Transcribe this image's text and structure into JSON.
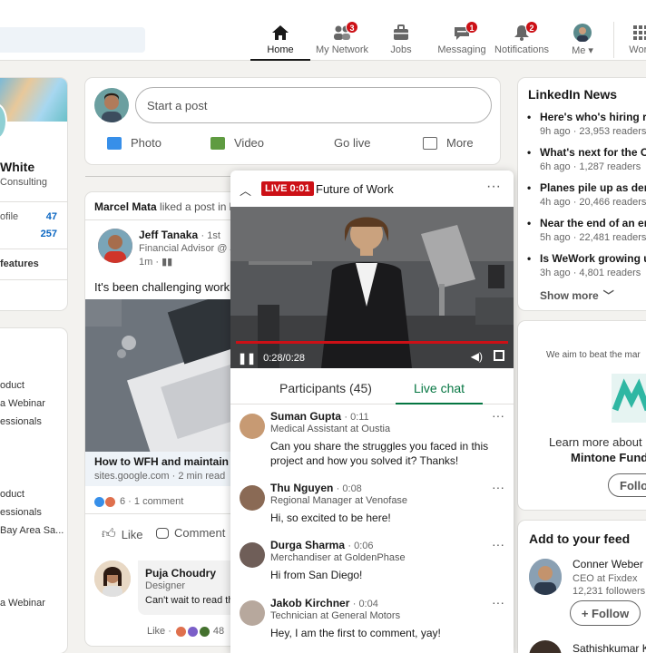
{
  "nav": {
    "items": [
      {
        "label": "Home",
        "icon": "home-icon",
        "badge": ""
      },
      {
        "label": "My Network",
        "icon": "network-icon",
        "badge": "3"
      },
      {
        "label": "Jobs",
        "icon": "briefcase-icon",
        "badge": ""
      },
      {
        "label": "Messaging",
        "icon": "messaging-icon",
        "badge": "1"
      },
      {
        "label": "Notifications",
        "icon": "bell-icon",
        "badge": "2"
      },
      {
        "label": "Me",
        "icon": "avatar-icon",
        "badge": ""
      },
      {
        "label": "Work",
        "icon": "grid-icon",
        "badge": ""
      }
    ]
  },
  "profile": {
    "name": "White",
    "headline": "Consulting",
    "stats": [
      {
        "label": "ofile",
        "value": "47"
      },
      {
        "label": "",
        "value": "257"
      }
    ],
    "features_label": "features"
  },
  "left_list": [
    "oduct",
    "a Webinar",
    "essionals",
    "oduct",
    "essionals",
    "Bay Area Sa...",
    "a Webinar"
  ],
  "post_box": {
    "placeholder": "Start a post",
    "actions": [
      {
        "label": "Photo",
        "color": "#378fe9"
      },
      {
        "label": "Video",
        "color": "#5f9b41"
      },
      {
        "label": "Go live",
        "color": ""
      },
      {
        "label": "More",
        "color": "#666666"
      }
    ]
  },
  "feed_post": {
    "liked_by": "Marcel Mata",
    "liked_text": "liked a post in",
    "liked_trail": "L",
    "author": "Jeff Tanaka",
    "degree": "· 1st",
    "author_title": "Financial Advisor @ J",
    "time": "1m ·",
    "text": "It's been challenging workin",
    "link_title": "How to WFH and maintain b",
    "link_meta": "sites.google.com · 2 min read",
    "reactions": "6 · 1 comment",
    "like_label": "Like",
    "comment_label": "Comment",
    "commenter": "Puja Choudry",
    "commenter_title": "Designer",
    "comment_text": "Can't wait to read th",
    "comment_actions": "Like ·",
    "comment_reactions": "48"
  },
  "live": {
    "badge": "LIVE 0:01",
    "title": "Future of Work",
    "time": "0:28/0:28",
    "progress": 1.0,
    "tabs": [
      {
        "label": "Participants (45)",
        "active": false
      },
      {
        "label": "Live chat",
        "active": true
      }
    ],
    "messages": [
      {
        "name": "Suman Gupta",
        "time": "· 0:11",
        "role": "Medical Assistant at Oustia",
        "text": "Can you share the struggles you faced in this project and how you solved it? Thanks!"
      },
      {
        "name": "Thu Nguyen",
        "time": "· 0:08",
        "role": "Regional Manager at Venofase",
        "text": "Hi, so excited to be here!"
      },
      {
        "name": "Durga Sharma",
        "time": "· 0:06",
        "role": "Merchandiser at GoldenPhase",
        "text": "Hi from San Diego!"
      },
      {
        "name": "Jakob Kirchner",
        "time": "· 0:04",
        "role": "Technician at General Motors",
        "text": "Hey, I am the first to comment, yay!"
      }
    ]
  },
  "news": {
    "title": "LinkedIn News",
    "items": [
      {
        "title": "Here's who's hiring ri",
        "meta": "9h ago · 23,953 readers"
      },
      {
        "title": "What's next for the O",
        "meta": "6h ago · 1,287 readers"
      },
      {
        "title": "Planes pile up as dem",
        "meta": "4h ago · 20,466 readers"
      },
      {
        "title": "Near the end of an er",
        "meta": "5h ago · 22,481 readers"
      },
      {
        "title": "Is WeWork growing u",
        "meta": "3h ago · 4,801 readers"
      }
    ],
    "show_more": "Show more"
  },
  "ad": {
    "tagline": "We aim to beat the mar",
    "learn": "Learn more about",
    "brand": "Mintone Fund",
    "follow": "Follo"
  },
  "feed_suggest": {
    "title": "Add to your feed",
    "person": "Conner Weber",
    "role": "CEO at Fixdex",
    "followers": "12,231 followers",
    "follow": "+ Follow",
    "next": "Sathishkumar K"
  }
}
